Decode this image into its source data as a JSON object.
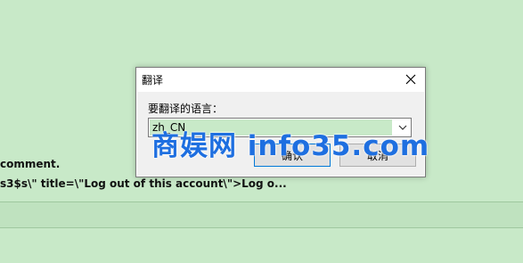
{
  "background": {
    "line1": "comment.",
    "line2": "s3$s\\\" title=\\\"Log out of this account\\\">Log o..."
  },
  "dialog": {
    "title": "翻译",
    "field_label": "要翻译的语言：",
    "select_value": "zh_CN",
    "ok_label": "确认",
    "cancel_label": "取消"
  },
  "watermark": "商娱网 info35.com",
  "colors": {
    "background": "#c8e9c8",
    "watermark": "#1e6fe0",
    "focus_border": "#0078d7"
  },
  "icons": {
    "close": "close-icon",
    "dropdown": "chevron-down-icon"
  }
}
